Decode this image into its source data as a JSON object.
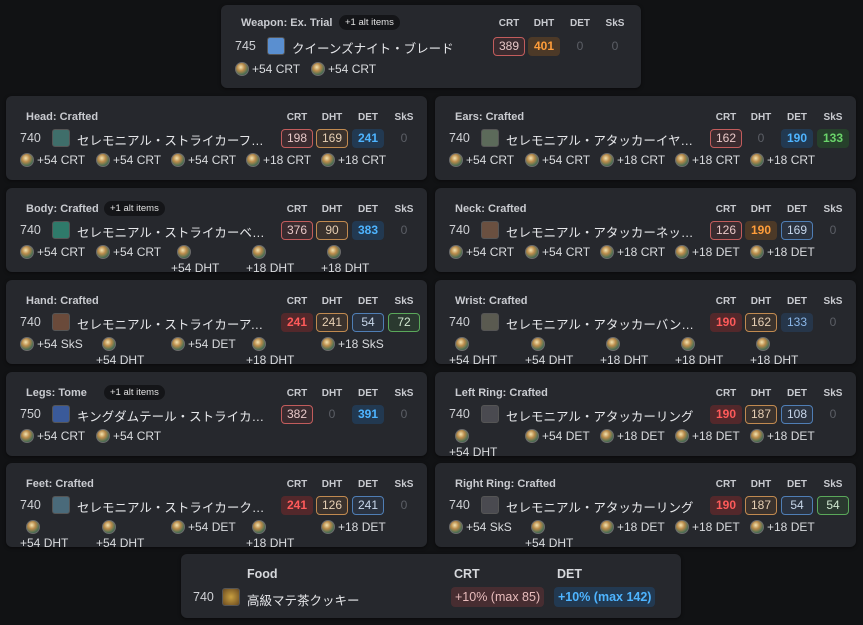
{
  "stat_headers": [
    "CRT",
    "DHT",
    "DET",
    "SkS"
  ],
  "weapon": {
    "slot": "Weapon: Ex. Trial",
    "alt": "+1 alt items",
    "ilvl": "745",
    "name": "クイーンズナイト・ブレード",
    "icon_color": "#5a8fd0",
    "values": [
      "389",
      "401",
      "0",
      "0"
    ],
    "materia": [
      "+54 CRT",
      "+54 CRT"
    ]
  },
  "slots": [
    {
      "slot": "Head: Crafted",
      "ilvl": "740",
      "name": "セレモニアル・ストライカーフラ…",
      "icon_color": "#3f6e6a",
      "values": [
        "198",
        "169",
        "241",
        "0"
      ],
      "materia": [
        "+54 CRT",
        "+54 CRT",
        "+54 CRT",
        "+18 CRT",
        "+18 CRT"
      ]
    },
    {
      "slot": "Ears: Crafted",
      "ilvl": "740",
      "name": "セレモニアル・アタッカーイヤリ…",
      "icon_color": "#5c6a5a",
      "values": [
        "162",
        "0",
        "190",
        "133"
      ],
      "materia": [
        "+54 CRT",
        "+54 CRT",
        "+18 CRT",
        "+18 CRT",
        "+18 CRT"
      ]
    },
    {
      "slot": "Body: Crafted",
      "alt": "+1 alt items",
      "ilvl": "740",
      "name": "セレモニアル・ストライカーベスト",
      "icon_color": "#2f7a6a",
      "values": [
        "376",
        "90",
        "383",
        "0"
      ],
      "materia": [
        "+54 CRT",
        "+54 CRT",
        "+54 DHT",
        "+18 DHT",
        "+18 DHT"
      ]
    },
    {
      "slot": "Neck: Crafted",
      "ilvl": "740",
      "name": "セレモニアル・アタッカーネック…",
      "icon_color": "#6a5040",
      "values": [
        "126",
        "190",
        "169",
        "0"
      ],
      "materia": [
        "+54 CRT",
        "+54 CRT",
        "+18 CRT",
        "+18 DET",
        "+18 DET"
      ]
    },
    {
      "slot": "Hand: Crafted",
      "ilvl": "740",
      "name": "セレモニアル・ストライカーアー…",
      "icon_color": "#6a4a3a",
      "values": [
        "241",
        "241",
        "54",
        "72"
      ],
      "materia": [
        "+54 SkS",
        "+54 DHT",
        "+54 DET",
        "+18 DHT",
        "+18 SkS"
      ]
    },
    {
      "slot": "Wrist: Crafted",
      "ilvl": "740",
      "name": "セレモニアル・アタッカーバングル",
      "icon_color": "#5a5a50",
      "values": [
        "190",
        "162",
        "133",
        "0"
      ],
      "materia": [
        "+54 DHT",
        "+54 DHT",
        "+18 DHT",
        "+18 DHT",
        "+18 DHT"
      ]
    },
    {
      "slot": "Legs: Tome",
      "alt": "+1 alt items",
      "ilvl": "750",
      "name": "キングダムテール・ストライカー…",
      "icon_color": "#3a5a9a",
      "values": [
        "382",
        "0",
        "391",
        "0"
      ],
      "materia": [
        "+54 CRT",
        "+54 CRT"
      ]
    },
    {
      "slot": "Left Ring: Crafted",
      "ilvl": "740",
      "name": "セレモニアル・アタッカーリング",
      "icon_color": "#4a4a50",
      "values": [
        "190",
        "187",
        "108",
        "0"
      ],
      "materia": [
        "+54 DHT",
        "+54 DET",
        "+18 DET",
        "+18 DET",
        "+18 DET"
      ]
    },
    {
      "slot": "Feet: Crafted",
      "ilvl": "740",
      "name": "セレモニアル・ストライカークラ…",
      "icon_color": "#4a6a7a",
      "values": [
        "241",
        "126",
        "241",
        "0"
      ],
      "materia": [
        "+54 DHT",
        "+54 DHT",
        "+54 DET",
        "+18 DHT",
        "+18 DET"
      ]
    },
    {
      "slot": "Right Ring: Crafted",
      "ilvl": "740",
      "name": "セレモニアル・アタッカーリング",
      "icon_color": "#4a4a50",
      "values": [
        "190",
        "187",
        "54",
        "54"
      ],
      "materia": [
        "+54 SkS",
        "+54 DHT",
        "+18 DET",
        "+18 DET",
        "+18 DET"
      ]
    }
  ],
  "food": {
    "label": "Food",
    "ilvl": "740",
    "name": "高級マテ茶クッキー",
    "stat1": "CRT",
    "stat1_value": "+10% (max 85)",
    "stat2": "DET",
    "stat2_value": "+10% (max 142)"
  }
}
